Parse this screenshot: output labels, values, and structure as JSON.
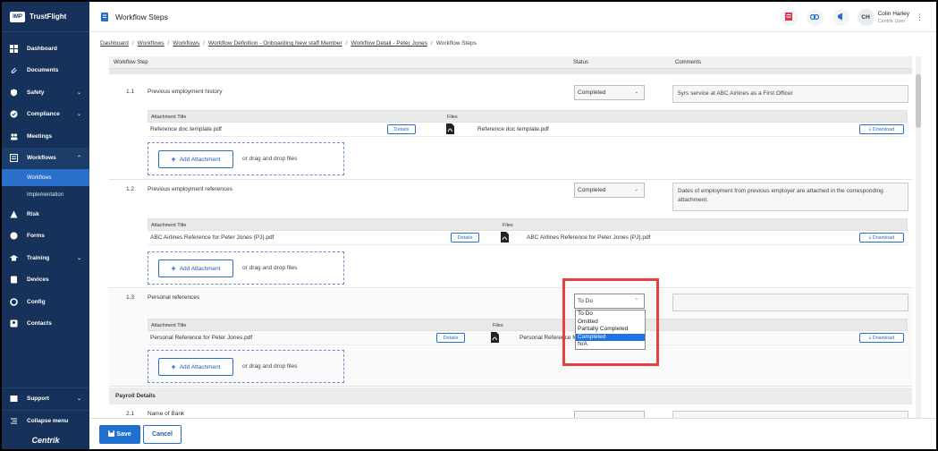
{
  "brand": {
    "logo": "IMP",
    "name": "TrustFlight"
  },
  "sidebar": {
    "items": [
      {
        "label": "Dashboard",
        "icon": "dashboard-icon"
      },
      {
        "label": "Documents",
        "icon": "paperclip-icon"
      },
      {
        "label": "Safety",
        "icon": "shield-icon",
        "chevron": "⌄"
      },
      {
        "label": "Compliance",
        "icon": "compliance-icon",
        "chevron": "⌄"
      },
      {
        "label": "Meetings",
        "icon": "people-icon"
      },
      {
        "label": "Workflows",
        "icon": "workflow-icon",
        "chevron": "⌃"
      }
    ],
    "subitems": [
      {
        "label": "Workflows"
      },
      {
        "label": "Implementation"
      }
    ],
    "items2": [
      {
        "label": "Risk"
      },
      {
        "label": "Forms"
      },
      {
        "label": "Training",
        "chevron": "⌄"
      },
      {
        "label": "Devices"
      },
      {
        "label": "Config"
      },
      {
        "label": "Contacts"
      }
    ],
    "support": {
      "label": "Support",
      "chevron": "⌄"
    },
    "collapse": {
      "label": "Collapse menu"
    },
    "footer_logo": "Centrik"
  },
  "header": {
    "title": "Workflow Steps",
    "user": {
      "initials": "CH",
      "name": "Colin Harley",
      "role": "Centrik User"
    },
    "kebab": "⋮"
  },
  "breadcrumb": {
    "links": [
      "Dashboard",
      "Workflows",
      "Workflows",
      "Workflow Definition - Onboarding New staff Member",
      "Workflow Detail - Peter Jones"
    ],
    "current": "Workflow Steps",
    "separator": "/"
  },
  "columns": {
    "step": "Workflow Step",
    "status": "Status",
    "comments": "Comments"
  },
  "attachment_columns": {
    "title": "Attachment Title",
    "files": "Files"
  },
  "labels": {
    "details": "Details",
    "download": "Download",
    "add_attachment": "Add Attachment",
    "drag_drop": "or drag and drop files",
    "plus": "+",
    "caret": "⌄",
    "caret_up": "⌃",
    "download_glyph": "⤓"
  },
  "steps": [
    {
      "number": "1.1",
      "name": "Previous employment history",
      "status": "Completed",
      "comment": "5yrs service at ABC Airlines as a First Officer",
      "attachment": {
        "title": "Reference doc template.pdf",
        "file": "Reference doc template.pdf"
      }
    },
    {
      "number": "1.2",
      "name": "Previous employment references",
      "status": "Completed",
      "comment": "Dates of employment from previous employer are attached in the corresponding attachment.",
      "attachment": {
        "title": "ABC Airlines Reference for Peter Jones (PJ).pdf",
        "file": "ABC Airlines Reference for Peter Jones (PJ).pdf"
      }
    },
    {
      "number": "1.3",
      "name": "Personal references",
      "status": "To Do",
      "comment": "",
      "attachment": {
        "title": "Personal Reference for Peter Jones.pdf",
        "file": "Personal Reference for Peter Jones.pdf"
      }
    }
  ],
  "status_options": [
    "To Do",
    "Omitted",
    "Partially Completed",
    "Completed",
    "N/A"
  ],
  "status_highlighted": "Completed",
  "payroll": {
    "section": "Payroll Details",
    "step_number": "2.1",
    "step_name": "Name of Bank"
  },
  "footer": {
    "save": "Save",
    "cancel": "Cancel"
  },
  "colors": {
    "sidebar": "#17325a",
    "accent": "#1f6fd1",
    "highlight": "#e8403c"
  }
}
